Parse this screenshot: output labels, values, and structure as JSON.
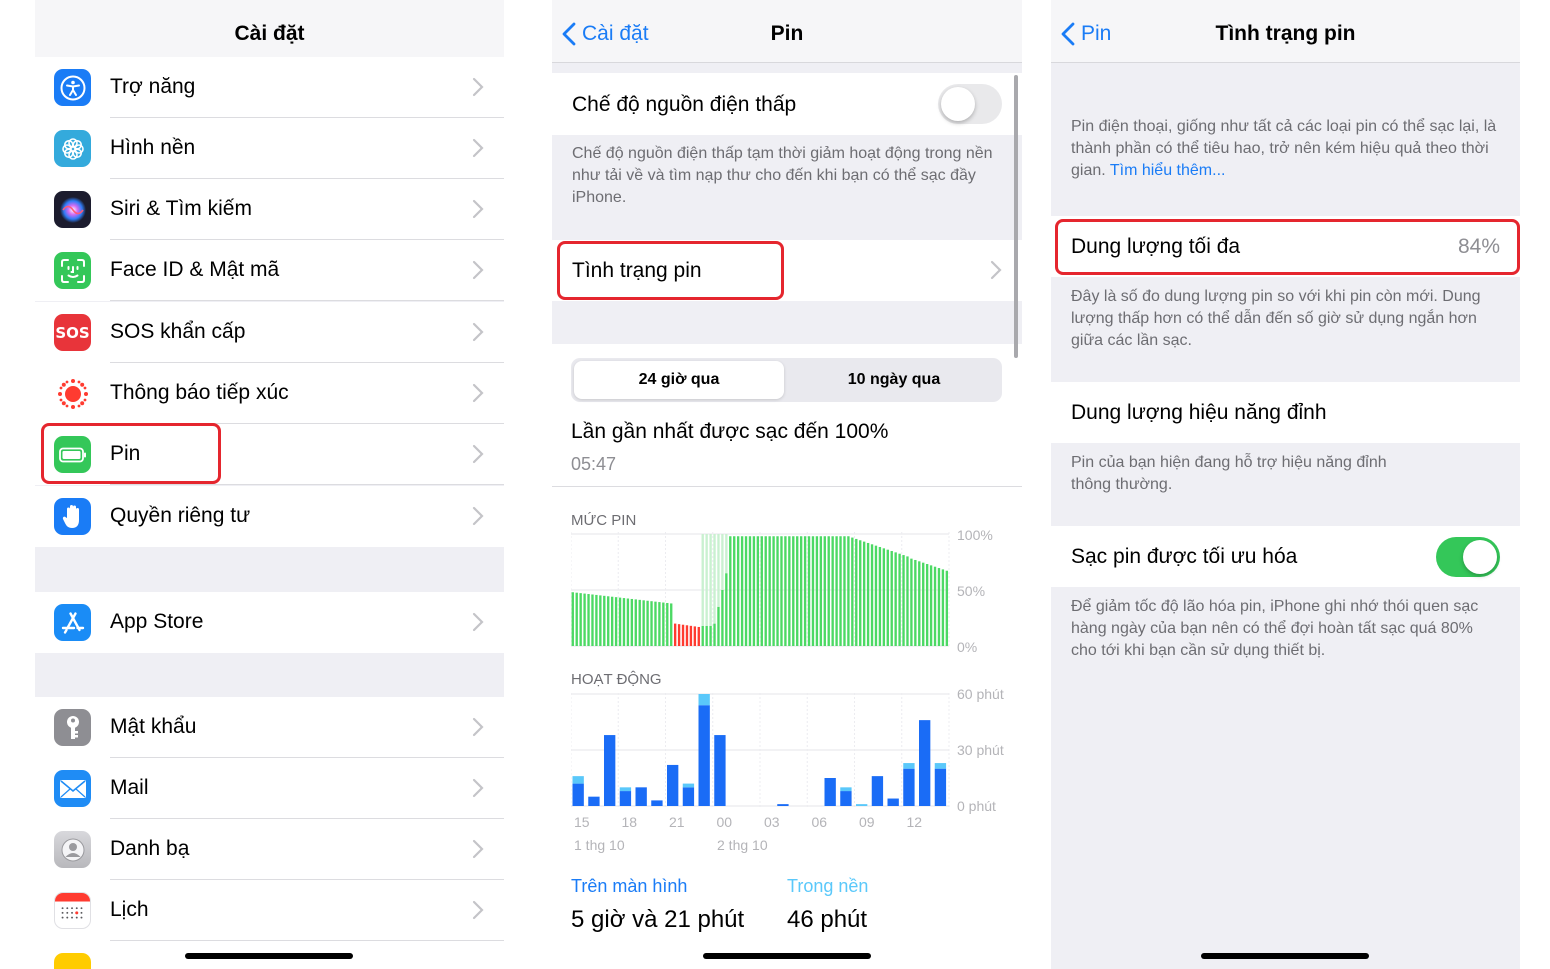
{
  "panel1": {
    "title": "Cài đặt",
    "group1": [
      {
        "label": "Trợ năng",
        "icon": "accessibility-icon",
        "color": "#1a7cf6"
      },
      {
        "label": "Hình nền",
        "icon": "wallpaper-icon",
        "color": "#34aadc"
      },
      {
        "label": "Siri & Tìm kiếm",
        "icon": "siri-icon",
        "color": "#1c1c2e"
      },
      {
        "label": "Face ID & Mật mã",
        "icon": "face-id-icon",
        "color": "#34c759"
      },
      {
        "label": "SOS khẩn cấp",
        "icon": "sos-icon",
        "color": "#e8343a"
      },
      {
        "label": "Thông báo tiếp xúc",
        "icon": "exposure-icon",
        "color": "#ffffff"
      },
      {
        "label": "Pin",
        "icon": "battery-icon",
        "color": "#34c759"
      },
      {
        "label": "Quyền riêng tư",
        "icon": "privacy-hand-icon",
        "color": "#1a7cf6"
      }
    ],
    "group2": [
      {
        "label": "App Store",
        "icon": "app-store-icon",
        "color": "#1a8cf6"
      }
    ],
    "group3": [
      {
        "label": "Mật khẩu",
        "icon": "key-icon",
        "color": "#8e8e93"
      },
      {
        "label": "Mail",
        "icon": "mail-icon",
        "color": "#1f8cf5"
      },
      {
        "label": "Danh bạ",
        "icon": "contacts-icon",
        "color": "#c8c8cc"
      },
      {
        "label": "Lịch",
        "icon": "calendar-icon",
        "color": "#ffffff"
      }
    ],
    "sos_text": "SOS"
  },
  "panel2": {
    "back": "Cài đặt",
    "title": "Pin",
    "low_power_label": "Chế độ nguồn điện thấp",
    "low_power_desc": "Chế độ nguồn điện thấp tạm thời giảm hoạt động trong nền như tải về và tìm nạp thư cho đến khi bạn có thể sạc đầy iPhone.",
    "battery_health_label": "Tình trạng pin",
    "segments": [
      "24 giờ qua",
      "10 ngày qua"
    ],
    "last_charged_label": "Lần gần nhất được sạc đến 100%",
    "last_charged_time": "05:47",
    "level_label": "MỨC PIN",
    "level_ticks": [
      "100%",
      "50%",
      "0%"
    ],
    "activity_label": "HOẠT ĐỘNG",
    "activity_ticks": [
      "60 phút",
      "30 phút",
      "0 phút"
    ],
    "hour_labels": [
      "15",
      "18",
      "21",
      "00",
      "03",
      "06",
      "09",
      "12"
    ],
    "date_labels": [
      "1 thg 10",
      "2 thg 10"
    ],
    "screen_on_label": "Trên màn hình",
    "screen_on_value": "5 giờ và 21 phút",
    "background_label": "Trong nền",
    "background_value": "46 phút",
    "colors": {
      "green": "#4cd964",
      "red": "#ff3b30",
      "blue": "#1a6cf6",
      "light_blue": "#5ac8fa"
    }
  },
  "panel3": {
    "back": "Pin",
    "title": "Tình trạng pin",
    "intro": "Pin điện thoại, giống như tất cả các loại pin có thể sạc lại, là thành phần có thể tiêu hao, trở nên kém hiệu quả theo thời gian.",
    "learn_more": "Tìm hiểu thêm...",
    "max_capacity_label": "Dung lượng tối đa",
    "max_capacity_value": "84%",
    "max_capacity_desc": "Đây là số đo dung lượng pin so với khi pin còn mới. Dung lượng thấp hơn có thể dẫn đến số giờ sử dụng ngắn hơn giữa các lần sạc.",
    "peak_label": "Dung lượng hiệu năng đỉnh",
    "peak_desc": "Pin của bạn hiện đang hỗ trợ hiệu năng đỉnh thông thường.",
    "optimized_label": "Sạc pin được tối ưu hóa",
    "optimized_desc": "Để giảm tốc độ lão hóa pin, iPhone ghi nhớ thói quen sạc hàng ngày của bạn nên có thể đợi hoàn tất sạc quá 80% cho tới khi bạn cần sử dụng thiết bị."
  }
}
